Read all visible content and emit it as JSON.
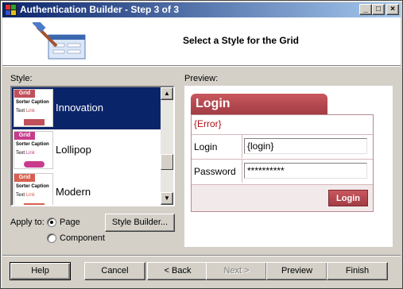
{
  "window": {
    "title": "Authentication Builder - Step 3 of 3",
    "controls": {
      "minimize": "_",
      "maximize": "□",
      "close": "×"
    }
  },
  "header": {
    "heading": "Select a Style for the Grid"
  },
  "style_section": {
    "label": "Style:",
    "items": [
      {
        "name": "Innovation",
        "selected": true,
        "accent": "#c0505a"
      },
      {
        "name": "Lollipop",
        "selected": false,
        "accent": "#c83c8c"
      },
      {
        "name": "Modern",
        "selected": false,
        "accent": "#d86050"
      }
    ],
    "thumbnail": {
      "head": "Grid",
      "col1": "Sorter",
      "col2": "Caption",
      "cell1": "Text",
      "cell2": "Link"
    }
  },
  "apply_to": {
    "label": "Apply to:",
    "options": [
      {
        "label": "Page",
        "checked": true
      },
      {
        "label": "Component",
        "checked": false
      }
    ]
  },
  "style_builder_button": "Style Builder...",
  "preview": {
    "label": "Preview:",
    "login": {
      "title": "Login",
      "error": "{Error}",
      "login_label": "Login",
      "login_value": "{login}",
      "password_label": "Password",
      "password_value": "**********",
      "button": "Login"
    }
  },
  "footer_buttons": {
    "help": "Help",
    "cancel": "Cancel",
    "back": "< Back",
    "next": "Next >",
    "preview": "Preview",
    "finish": "Finish"
  },
  "colors": {
    "title_bar": "#0a246a",
    "selection": "#0a246a",
    "login_accent": "#b0464e"
  }
}
